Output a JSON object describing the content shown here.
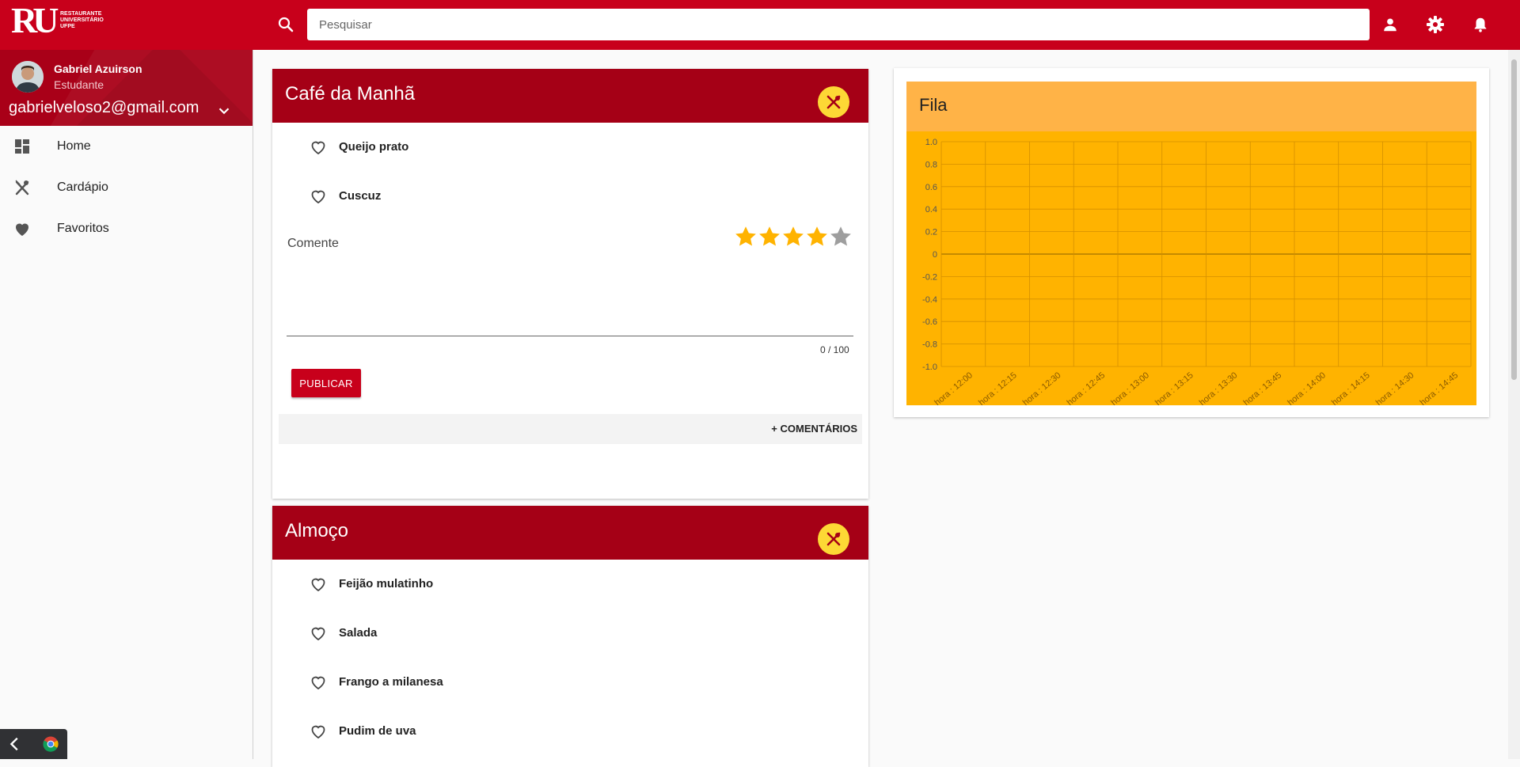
{
  "app": {
    "logo_text": "RESTAURANTE\nUNIVERSITÁRIO\nUFPE",
    "logo_mark": "RU"
  },
  "search": {
    "placeholder": "Pesquisar",
    "value": ""
  },
  "topbar_icons": [
    "person-icon",
    "settings-icon",
    "notifications-icon"
  ],
  "profile": {
    "name": "Gabriel Azuirson",
    "role": "Estudante",
    "email": "gabrielveloso2@gmail.com"
  },
  "nav": [
    {
      "label": "Home",
      "icon": "dashboard-icon"
    },
    {
      "label": "Cardápio",
      "icon": "restaurant-icon"
    },
    {
      "label": "Favoritos",
      "icon": "heart-icon"
    }
  ],
  "meals": [
    {
      "title": "Café da Manhã",
      "dishes": [
        "Queijo prato",
        "Cuscuz"
      ],
      "comment_label": "Comente",
      "rating": 4,
      "max_rating": 5,
      "char_count": "0 / 100",
      "publish_label": "PUBLICAR",
      "comments_label": "+ COMENTÁRIOS"
    },
    {
      "title": "Almoço",
      "dishes": [
        "Feijão mulatinho",
        "Salada",
        "Frango a milanesa",
        "Pudim de uva"
      ]
    }
  ],
  "colors": {
    "brand_red": "#c8001b",
    "card_header_red": "#a50016",
    "badge_yellow": "#fdd835",
    "star_gold": "#ffb300",
    "star_empty": "#9e9e9e",
    "chart_header": "#ffb347",
    "chart_bg": "#ffb300"
  },
  "chart_data": {
    "type": "line",
    "title": "Fila",
    "categories": [
      "hora : 12:00",
      "hora : 12:15",
      "hora : 12:30",
      "hora : 12:45",
      "hora : 13:00",
      "hora : 13:15",
      "hora : 13:30",
      "hora : 13:45",
      "hora : 14:00",
      "hora : 14:15",
      "hora : 14:30",
      "hora : 14:45"
    ],
    "yticks": [
      "1.0",
      "0.8",
      "0.6",
      "0.4",
      "0.2",
      "0",
      "-0.2",
      "-0.4",
      "-0.6",
      "-0.8",
      "-1.0"
    ],
    "ylim": [
      -1.0,
      1.0
    ],
    "series": [],
    "grid": true
  }
}
